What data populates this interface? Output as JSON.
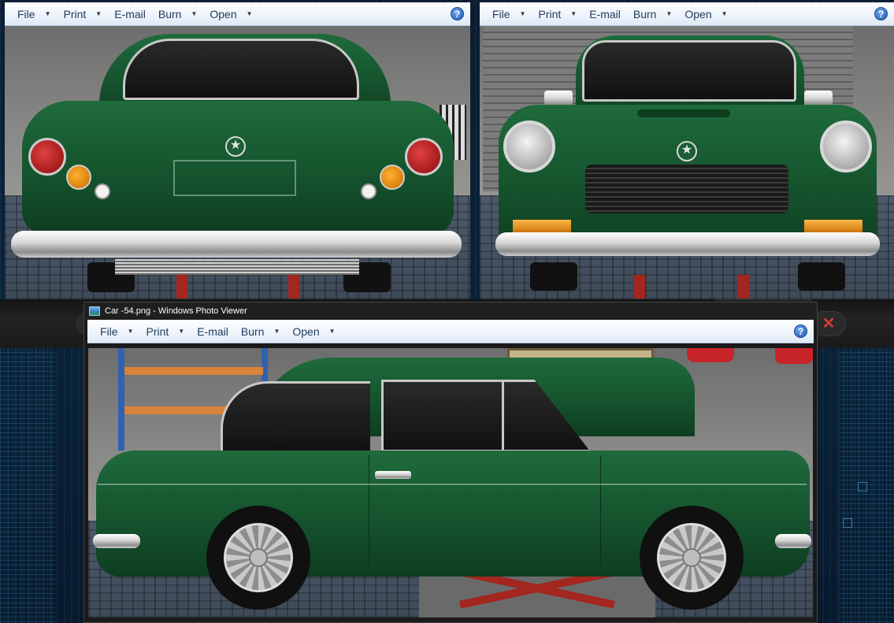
{
  "viewer_rear": {
    "menu": [
      {
        "label": "File",
        "has_caret": true
      },
      {
        "label": "Print",
        "has_caret": true
      },
      {
        "label": "E-mail",
        "has_caret": false
      },
      {
        "label": "Burn",
        "has_caret": true
      },
      {
        "label": "Open",
        "has_caret": true
      }
    ],
    "help_icon": "help-icon"
  },
  "viewer_front": {
    "menu": [
      {
        "label": "File",
        "has_caret": true
      },
      {
        "label": "Print",
        "has_caret": true
      },
      {
        "label": "E-mail",
        "has_caret": false
      },
      {
        "label": "Burn",
        "has_caret": true
      },
      {
        "label": "Open",
        "has_caret": true
      }
    ],
    "help_icon": "help-icon"
  },
  "viewer_side": {
    "title": "Car -54.png - Windows Photo Viewer",
    "menu": [
      {
        "label": "File",
        "has_caret": true
      },
      {
        "label": "Print",
        "has_caret": true
      },
      {
        "label": "E-mail",
        "has_caret": false
      },
      {
        "label": "Burn",
        "has_caret": true
      },
      {
        "label": "Open",
        "has_caret": true
      }
    ],
    "help_icon": "help-icon"
  },
  "taskbar_band": {
    "close_icon": "close-x-icon"
  },
  "colors": {
    "car_green": "#1f6b3c",
    "menu_text": "#1e395b",
    "close_red": "#d23a3a"
  }
}
